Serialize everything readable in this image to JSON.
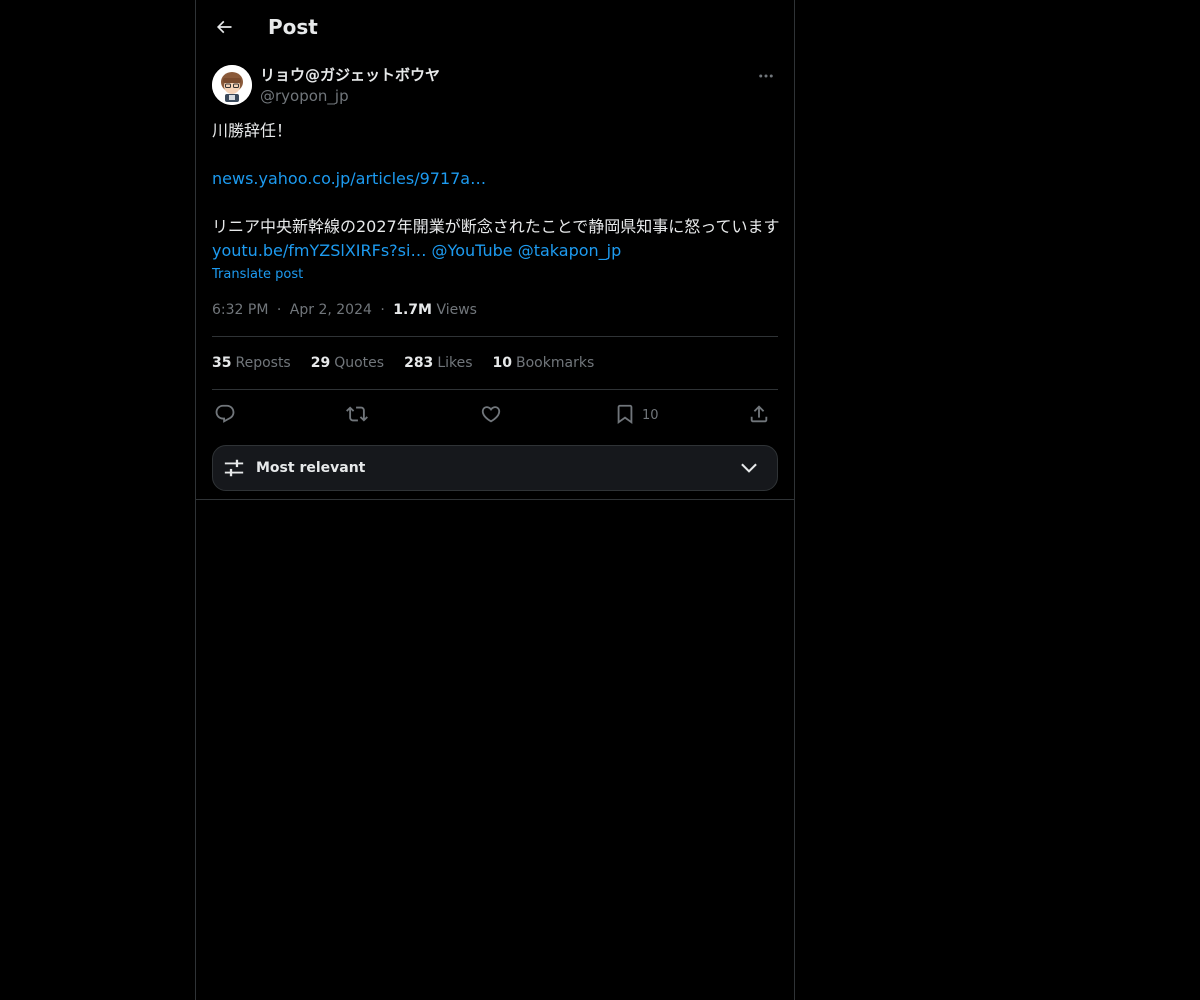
{
  "header": {
    "title": "Post",
    "back_icon": "arrow-left-icon"
  },
  "author": {
    "display_name": "リョウ@ガジェットボウヤ",
    "handle": "@ryopon_jp",
    "avatar_icon": "avatar-illustration"
  },
  "post": {
    "line1": "川勝辞任！",
    "link1": "news.yahoo.co.jp/articles/9717a…",
    "line3": "リニア中央新幹線の2027年開業が断念されたことで静岡県知事に怒っています ",
    "link2": "youtu.be/fmYZSlXIRFs?si…",
    "mention1": "@YouTube",
    "mention2": "@takapon_jp",
    "translate": "Translate post"
  },
  "meta": {
    "time": "6:32 PM",
    "date": "Apr 2, 2024",
    "views_count": "1.7M",
    "views_label": "Views",
    "separator": "·"
  },
  "stats": [
    {
      "num": "35",
      "label": "Reposts"
    },
    {
      "num": "29",
      "label": "Quotes"
    },
    {
      "num": "283",
      "label": "Likes"
    },
    {
      "num": "10",
      "label": "Bookmarks"
    }
  ],
  "actions": {
    "reply_icon": "reply-icon",
    "repost_icon": "repost-icon",
    "like_icon": "heart-icon",
    "bookmark_icon": "bookmark-icon",
    "bookmark_count": "10",
    "share_icon": "share-icon"
  },
  "sort": {
    "label": "Most relevant",
    "icon": "sliders-icon",
    "chevron": "chevron-down-icon"
  },
  "colors": {
    "background": "#000000",
    "text": "#e7e9ea",
    "muted": "#71767b",
    "link": "#1d9bf0",
    "border": "#2f3336"
  }
}
